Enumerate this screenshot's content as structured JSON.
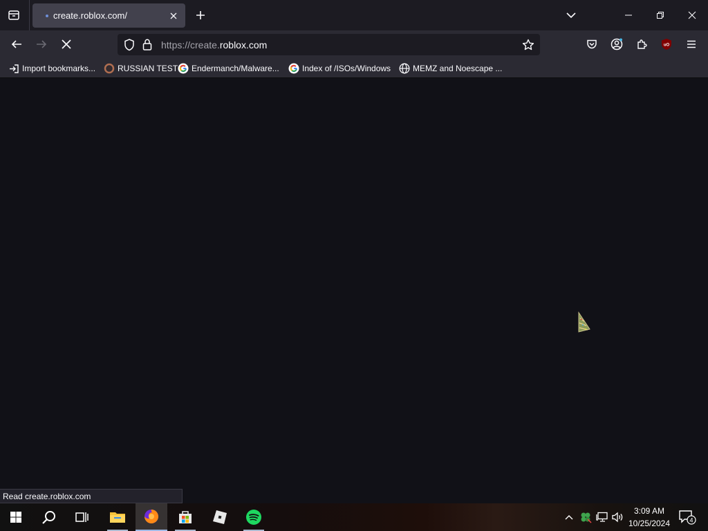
{
  "tab": {
    "title": "create.roblox.com/"
  },
  "address": {
    "prefix": "https://create.",
    "domain": "roblox.com"
  },
  "bookmarks": [
    {
      "label": "Import bookmarks...",
      "icon": "import-icon"
    },
    {
      "label": "RUSSIAN TEST",
      "icon": "bookmark-favicon"
    },
    {
      "label": "Endermanch/Malware...",
      "icon": "google-icon"
    },
    {
      "label": "Index of /ISOs/Windows",
      "icon": "google-icon"
    },
    {
      "label": "MEMZ and Noescape ...",
      "icon": "globe-icon"
    }
  ],
  "status_text": "Read create.roblox.com",
  "extension_badge": "uO",
  "clock": {
    "time": "3:09 AM",
    "date": "10/25/2024"
  },
  "notifications_count": "4",
  "colors": {
    "tab_active": "#42414d",
    "toolbar": "#2b2a33",
    "content_bg": "#111117",
    "urlbar_bg": "#1c1b22"
  }
}
